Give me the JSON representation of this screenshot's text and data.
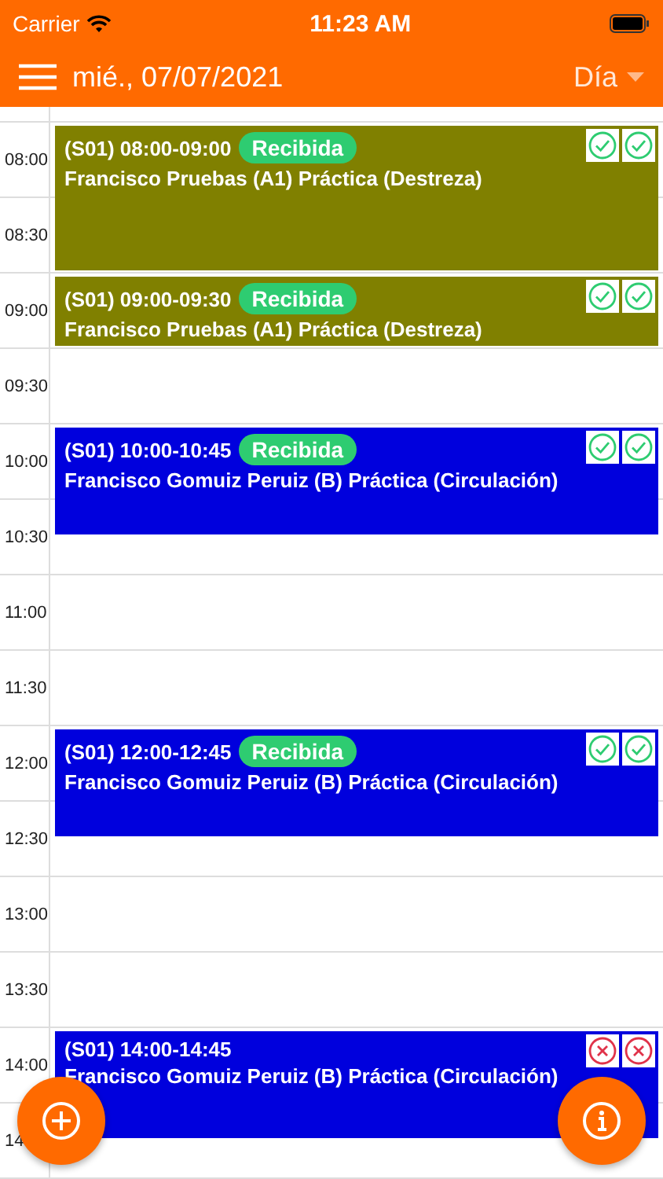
{
  "status_bar": {
    "carrier": "Carrier",
    "time": "11:23 AM"
  },
  "header": {
    "date": "mié., 07/07/2021",
    "view": "Día"
  },
  "slots": [
    {
      "label": "08:00",
      "events": [
        {
          "time": "(S01) 08:00-09:00",
          "badge": "Recibida",
          "title": "Francisco Pruebas (A1) Práctica (Destreza)",
          "color": "#808000",
          "marks": [
            {
              "kind": "check"
            },
            {
              "kind": "check"
            }
          ]
        }
      ]
    },
    {
      "label": "08:30"
    },
    {
      "label": "09:00",
      "events": [
        {
          "time": "(S01) 09:00-09:30",
          "badge": "Recibida",
          "title": "Francisco Pruebas (A1) Práctica (Destreza)",
          "color": "#808000",
          "marks": [
            {
              "kind": "check"
            },
            {
              "kind": "check"
            }
          ]
        }
      ]
    },
    {
      "label": "09:30"
    },
    {
      "label": "10:00",
      "events": [
        {
          "time": "(S01) 10:00-10:45",
          "badge": "Recibida",
          "title": "Francisco Gomuiz Peruiz (B) Práctica (Circulación)",
          "color": "#0000dd",
          "marks": [
            {
              "kind": "check"
            },
            {
              "kind": "check"
            }
          ]
        }
      ]
    },
    {
      "label": "10:30"
    },
    {
      "label": "11:00"
    },
    {
      "label": "11:30"
    },
    {
      "label": "12:00",
      "events": [
        {
          "time": "(S01) 12:00-12:45",
          "badge": "Recibida",
          "title": "Francisco Gomuiz Peruiz (B) Práctica (Circulación)",
          "color": "#0000dd",
          "marks": [
            {
              "kind": "check"
            },
            {
              "kind": "check"
            }
          ]
        }
      ]
    },
    {
      "label": "12:30"
    },
    {
      "label": "13:00"
    },
    {
      "label": "13:30"
    },
    {
      "label": "14:00",
      "events": [
        {
          "time": "(S01) 14:00-14:45",
          "title": "Francisco Gomuiz Peruiz (B) Práctica (Circulación)",
          "color": "#0000dd",
          "marks": [
            {
              "kind": "cross"
            },
            {
              "kind": "cross"
            }
          ]
        }
      ]
    },
    {
      "label": "14"
    }
  ],
  "fabs": [
    {
      "kind": "add"
    },
    {
      "kind": "info"
    }
  ]
}
